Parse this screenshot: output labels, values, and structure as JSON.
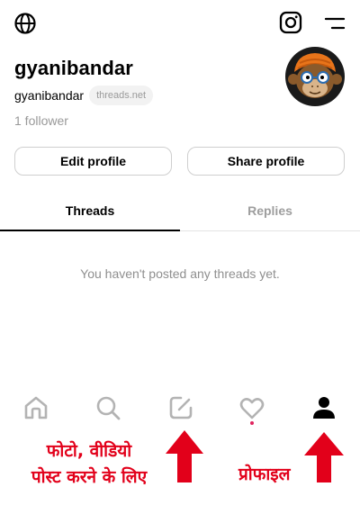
{
  "profile": {
    "username": "gyanibandar",
    "handle": "gyanibandar",
    "domain": "threads.net",
    "followers": "1 follower"
  },
  "buttons": {
    "edit": "Edit profile",
    "share": "Share profile"
  },
  "tabs": [
    {
      "label": "Threads",
      "active": true
    },
    {
      "label": "Replies",
      "active": false
    }
  ],
  "empty_state": "You haven't posted any threads yet.",
  "nav": {
    "items": [
      "home-icon",
      "search-icon",
      "compose-icon",
      "heart-icon",
      "profile-icon"
    ],
    "active": "profile-icon",
    "notification_dot_color": "#e0245e"
  },
  "annotations": {
    "compose_line1": "फोटो, वीडियो",
    "compose_line2": "पोस्ट करने के लिए",
    "profile": "प्रोफाइल",
    "color": "#e2001a"
  }
}
